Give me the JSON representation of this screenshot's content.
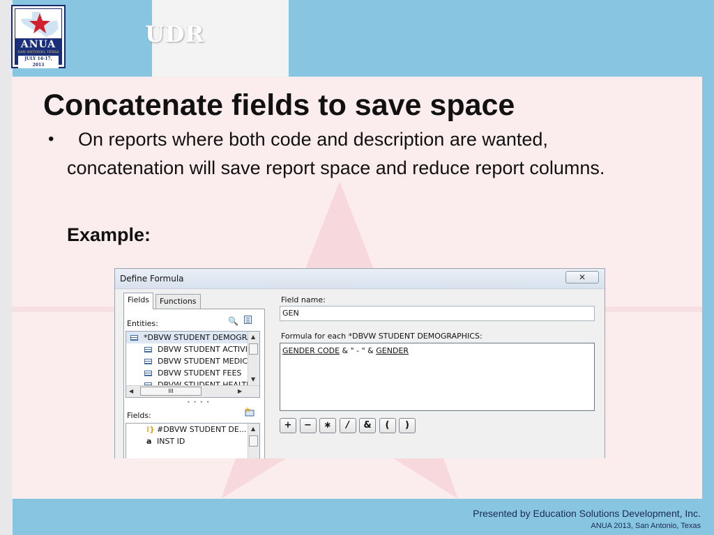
{
  "header": {
    "logo": {
      "title": "ANUA",
      "subtitle": "SAN ANTONIO, TEXAS",
      "dates": "JULY 14-17, 2013"
    },
    "section_label": "UDR"
  },
  "slide": {
    "title": "Concatenate fields to save space",
    "bullet": "On reports where both code and description are wanted, concatenation will save report space and reduce report columns.",
    "example_label": "Example:"
  },
  "dialog": {
    "title": "Define Formula",
    "close_label": "✕",
    "tabs": [
      "Fields",
      "Functions"
    ],
    "entities_label": "Entities:",
    "entities": [
      "*DBVW STUDENT DEMOGRAPHICS",
      "DBVW STUDENT ACTIVITIES",
      "DBVW STUDENT MEDICAL",
      "DBVW STUDENT FEES",
      "DBVW STUDENT HEALTH"
    ],
    "fields_label": "Fields:",
    "fields": [
      {
        "icon": "#-icon",
        "label": "#DBVW STUDENT DE..."
      },
      {
        "icon": "a",
        "label": "INST ID"
      }
    ],
    "field_name_label": "Field name:",
    "field_name_value": "GEN",
    "formula_label": "Formula for each *DBVW STUDENT DEMOGRAPHICS:",
    "formula": {
      "ref1": "GENDER CODE",
      "operator_text": " & \" - \" & ",
      "ref2": "GENDER"
    },
    "operators": [
      "+",
      "−",
      "∗",
      "/",
      "&",
      "(",
      ")"
    ]
  },
  "footer": {
    "presenter": "Presented by Education Solutions Development, Inc.",
    "event": "ANUA 2013, San Antonio, Texas"
  },
  "colors": {
    "background_blue": "#87c5e0",
    "panel_pink": "#fbecee",
    "logo_navy": "#1a2f7a",
    "logo_star_red": "#d3202f"
  }
}
